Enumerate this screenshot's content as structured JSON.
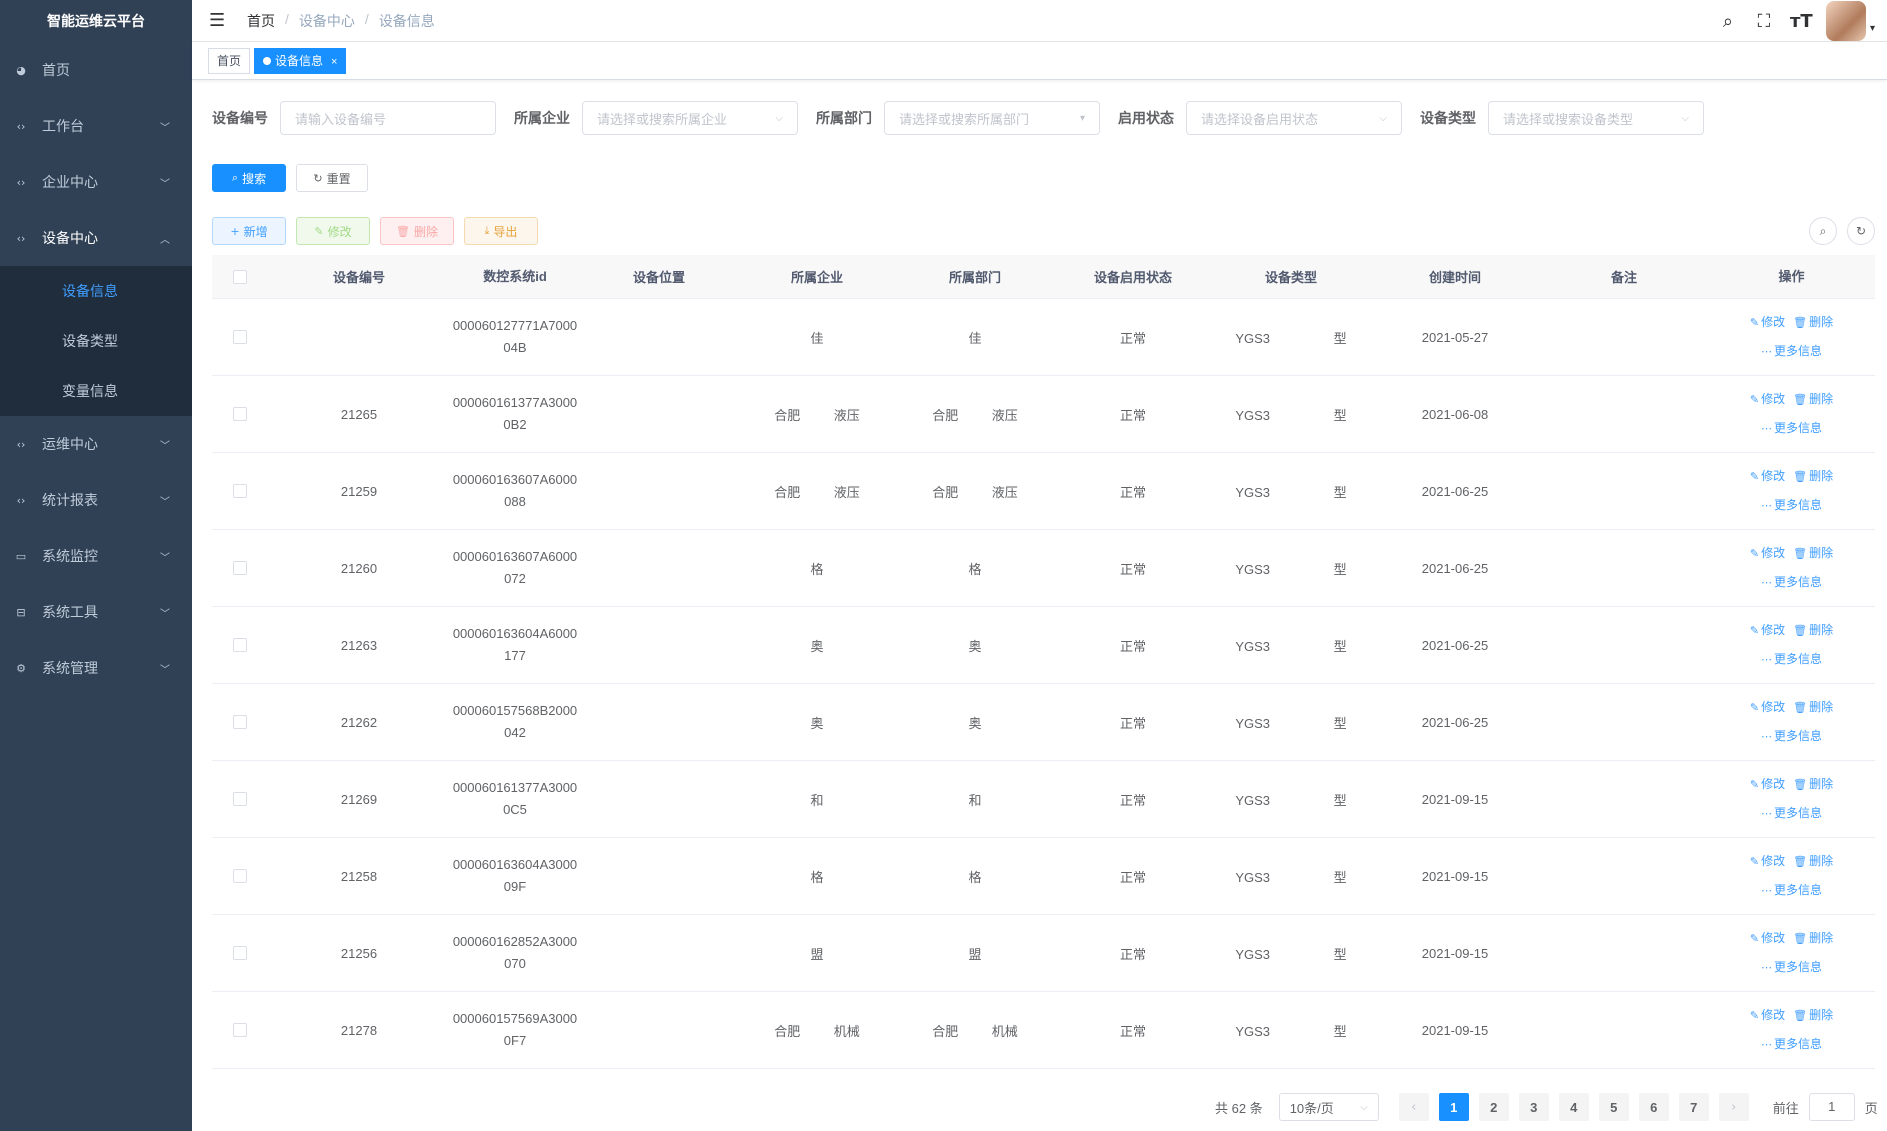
{
  "app": {
    "title": "智能运维云平台"
  },
  "sidebar": {
    "items": [
      {
        "label": "首页",
        "icon": "dashboard-icon",
        "glyph": "◕",
        "has_arrow": false
      },
      {
        "label": "工作台",
        "icon": "code-icon",
        "glyph": "‹›",
        "has_arrow": true
      },
      {
        "label": "企业中心",
        "icon": "code-icon",
        "glyph": "‹›",
        "has_arrow": true
      },
      {
        "label": "设备中心",
        "icon": "code-icon",
        "glyph": "‹›",
        "has_arrow": true,
        "expanded": true
      },
      {
        "label": "运维中心",
        "icon": "code-icon",
        "glyph": "‹›",
        "has_arrow": true
      },
      {
        "label": "统计报表",
        "icon": "code-icon",
        "glyph": "‹›",
        "has_arrow": true
      },
      {
        "label": "系统监控",
        "icon": "monitor-icon",
        "glyph": "▭",
        "has_arrow": true
      },
      {
        "label": "系统工具",
        "icon": "toolbox-icon",
        "glyph": "⊟",
        "has_arrow": true
      },
      {
        "label": "系统管理",
        "icon": "gear-icon",
        "glyph": "⚙",
        "has_arrow": true
      }
    ],
    "submenu": [
      {
        "label": "设备信息",
        "active": true
      },
      {
        "label": "设备类型",
        "active": false
      },
      {
        "label": "变量信息",
        "active": false
      }
    ]
  },
  "navbar": {
    "breadcrumb": [
      "首页",
      "设备中心",
      "设备信息"
    ]
  },
  "tags": [
    {
      "label": "首页",
      "active": false
    },
    {
      "label": "设备信息",
      "active": true
    }
  ],
  "filters": {
    "device_no": {
      "label": "设备编号",
      "placeholder": "请输入设备编号"
    },
    "enterprise": {
      "label": "所属企业",
      "placeholder": "请选择或搜索所属企业"
    },
    "department": {
      "label": "所属部门",
      "placeholder": "请选择或搜索所属部门"
    },
    "status": {
      "label": "启用状态",
      "placeholder": "请选择设备启用状态"
    },
    "type": {
      "label": "设备类型",
      "placeholder": "请选择或搜索设备类型"
    }
  },
  "buttons": {
    "search": "搜索",
    "reset": "重置",
    "add": "新增",
    "edit": "修改",
    "delete": "删除",
    "export": "导出"
  },
  "table": {
    "columns": [
      "设备编号",
      "数控系统id",
      "设备位置",
      "所属企业",
      "所属部门",
      "设备启用状态",
      "设备类型",
      "创建时间",
      "备注",
      "操作"
    ],
    "op_edit": "修改",
    "op_delete": "删除",
    "op_more": "更多信息",
    "rows": [
      {
        "no": "",
        "sys_id": "000060127771A7000 04B",
        "position": "",
        "enterprise": "佳",
        "department": "佳",
        "status": "正常",
        "type": "YGS3 型",
        "created": "2021-05-27",
        "remark": ""
      },
      {
        "no": "21265",
        "sys_id": "000060161377A3000 0B2",
        "position": "",
        "enterprise": "合肥 液压",
        "department": "合肥 液压",
        "status": "正常",
        "type": "YGS3 型",
        "created": "2021-06-08",
        "remark": ""
      },
      {
        "no": "21259",
        "sys_id": "000060163607A6000 088",
        "position": "",
        "enterprise": "合肥 液压",
        "department": "合肥 液压",
        "status": "正常",
        "type": "YGS3 型",
        "created": "2021-06-25",
        "remark": ""
      },
      {
        "no": "21260",
        "sys_id": "000060163607A6000 072",
        "position": "",
        "enterprise": "格",
        "department": "格",
        "status": "正常",
        "type": "YGS3 型",
        "created": "2021-06-25",
        "remark": ""
      },
      {
        "no": "21263",
        "sys_id": "000060163604A6000 177",
        "position": "",
        "enterprise": "奥",
        "department": "奥",
        "status": "正常",
        "type": "YGS3 型",
        "created": "2021-06-25",
        "remark": ""
      },
      {
        "no": "21262",
        "sys_id": "000060157568B2000 042",
        "position": "",
        "enterprise": "奥",
        "department": "奥",
        "status": "正常",
        "type": "YGS3 型",
        "created": "2021-06-25",
        "remark": ""
      },
      {
        "no": "21269",
        "sys_id": "000060161377A3000 0C5",
        "position": "",
        "enterprise": "和",
        "department": "和",
        "status": "正常",
        "type": "YGS3 型",
        "created": "2021-09-15",
        "remark": ""
      },
      {
        "no": "21258",
        "sys_id": "000060163604A3000 09F",
        "position": "",
        "enterprise": "格",
        "department": "格",
        "status": "正常",
        "type": "YGS3 型",
        "created": "2021-09-15",
        "remark": ""
      },
      {
        "no": "21256",
        "sys_id": "000060162852A3000 070",
        "position": "",
        "enterprise": "盟",
        "department": "盟",
        "status": "正常",
        "type": "YGS3 型",
        "created": "2021-09-15",
        "remark": ""
      },
      {
        "no": "21278",
        "sys_id": "000060157569A3000 0F7",
        "position": "",
        "enterprise": "合肥 机械",
        "department": "合肥 机械",
        "status": "正常",
        "type": "YGS3 型",
        "created": "2021-09-15",
        "remark": ""
      }
    ]
  },
  "pagination": {
    "total_text": "共 62 条",
    "page_size": "10条/页",
    "pages": [
      "1",
      "2",
      "3",
      "4",
      "5",
      "6",
      "7"
    ],
    "current": "1",
    "goto_prefix": "前往",
    "goto_value": "1",
    "goto_suffix": "页"
  },
  "colors": {
    "sidebar_bg": "#304156",
    "submenu_bg": "#1f2d3d",
    "primary": "#1890ff",
    "link": "#409eff"
  }
}
